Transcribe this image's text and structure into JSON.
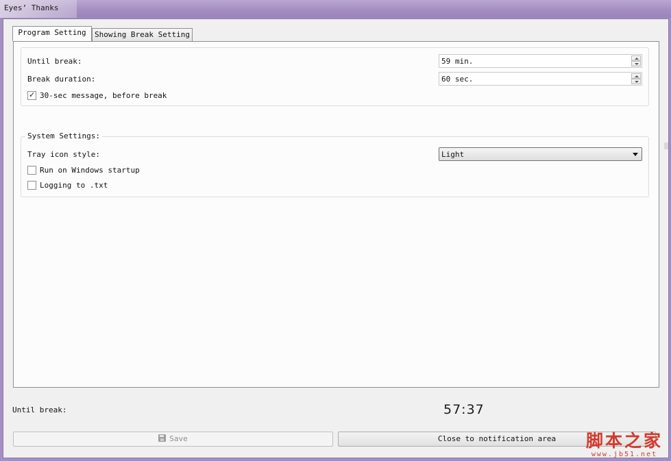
{
  "window": {
    "title": "Eyes’ Thanks"
  },
  "tabs": [
    {
      "label": "Program Setting",
      "active": true
    },
    {
      "label": "Showing Break Setting",
      "active": false
    }
  ],
  "program": {
    "until_break_label": "Until break:",
    "until_break_value": "59 min.",
    "break_duration_label": "Break duration:",
    "break_duration_value": "60 sec.",
    "message_checkbox": {
      "label": "30-sec message, before break",
      "checked": true
    }
  },
  "system": {
    "title": "System Settings:",
    "tray_style_label": "Tray icon style:",
    "tray_style_value": "Light",
    "startup_checkbox": {
      "label": "Run on Windows startup",
      "checked": false
    },
    "logging_checkbox": {
      "label": "Logging to .txt",
      "checked": false
    }
  },
  "status": {
    "until_break_label": "Until break:",
    "countdown": "57:37"
  },
  "buttons": {
    "save": "Save",
    "close": "Close to notification area"
  },
  "watermark": {
    "main": "脚本之家",
    "sub": "www.jb51.net"
  },
  "icons": {
    "save": "floppy-disk-icon"
  },
  "colors": {
    "frame": "#a58fc0",
    "watermark": "#d23b2f"
  }
}
